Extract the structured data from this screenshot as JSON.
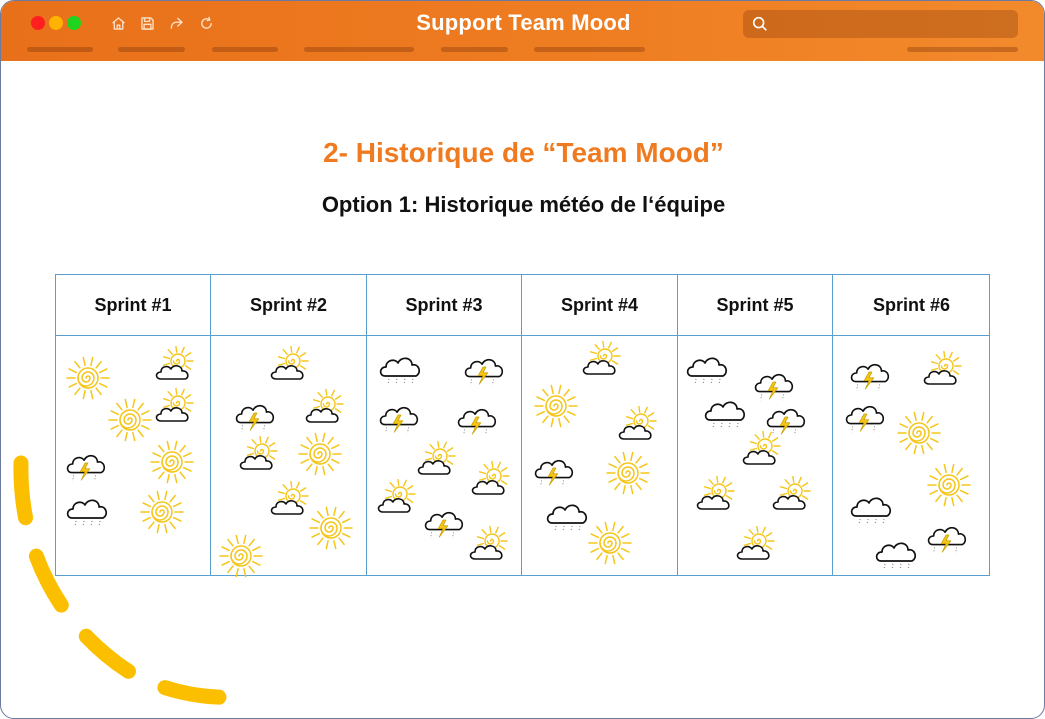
{
  "window": {
    "title": "Support Team Mood",
    "search_placeholder": ""
  },
  "toolbar": {
    "icons": [
      "home-icon",
      "save-icon",
      "share-icon",
      "refresh-icon"
    ]
  },
  "slide": {
    "title": "2- Historique de “Team Mood”",
    "subtitle": "Option 1: Historique météo de l‘équipe"
  },
  "colors": {
    "titlebar": "#ef7e22",
    "title_text": "#ef7a1f",
    "grid_border": "#5a9fd0",
    "sun": "#f5c518",
    "dash_arc": "#fcbf00"
  },
  "sprints": [
    {
      "label": "Sprint #1",
      "weather": [
        "sun",
        "sun-cloud",
        "sun",
        "sun-cloud",
        "storm",
        "sun",
        "cloud",
        "sun"
      ]
    },
    {
      "label": "Sprint #2",
      "weather": [
        "sun-cloud",
        "storm",
        "sun-cloud",
        "sun-cloud",
        "sun",
        "sun-cloud",
        "sun",
        "sun"
      ]
    },
    {
      "label": "Sprint #3",
      "weather": [
        "cloud",
        "storm",
        "storm",
        "storm",
        "sun-cloud",
        "sun-cloud",
        "sun-cloud",
        "storm",
        "sun-cloud"
      ]
    },
    {
      "label": "Sprint #4",
      "weather": [
        "sun-cloud",
        "sun",
        "sun-cloud",
        "storm",
        "sun",
        "cloud",
        "sun"
      ]
    },
    {
      "label": "Sprint #5",
      "weather": [
        "cloud",
        "storm",
        "cloud",
        "storm",
        "sun-cloud",
        "sun-cloud",
        "sun-cloud",
        "sun-cloud"
      ]
    },
    {
      "label": "Sprint #6",
      "weather": [
        "storm",
        "sun-cloud",
        "storm",
        "sun",
        "sun",
        "cloud",
        "storm",
        "cloud"
      ]
    }
  ]
}
